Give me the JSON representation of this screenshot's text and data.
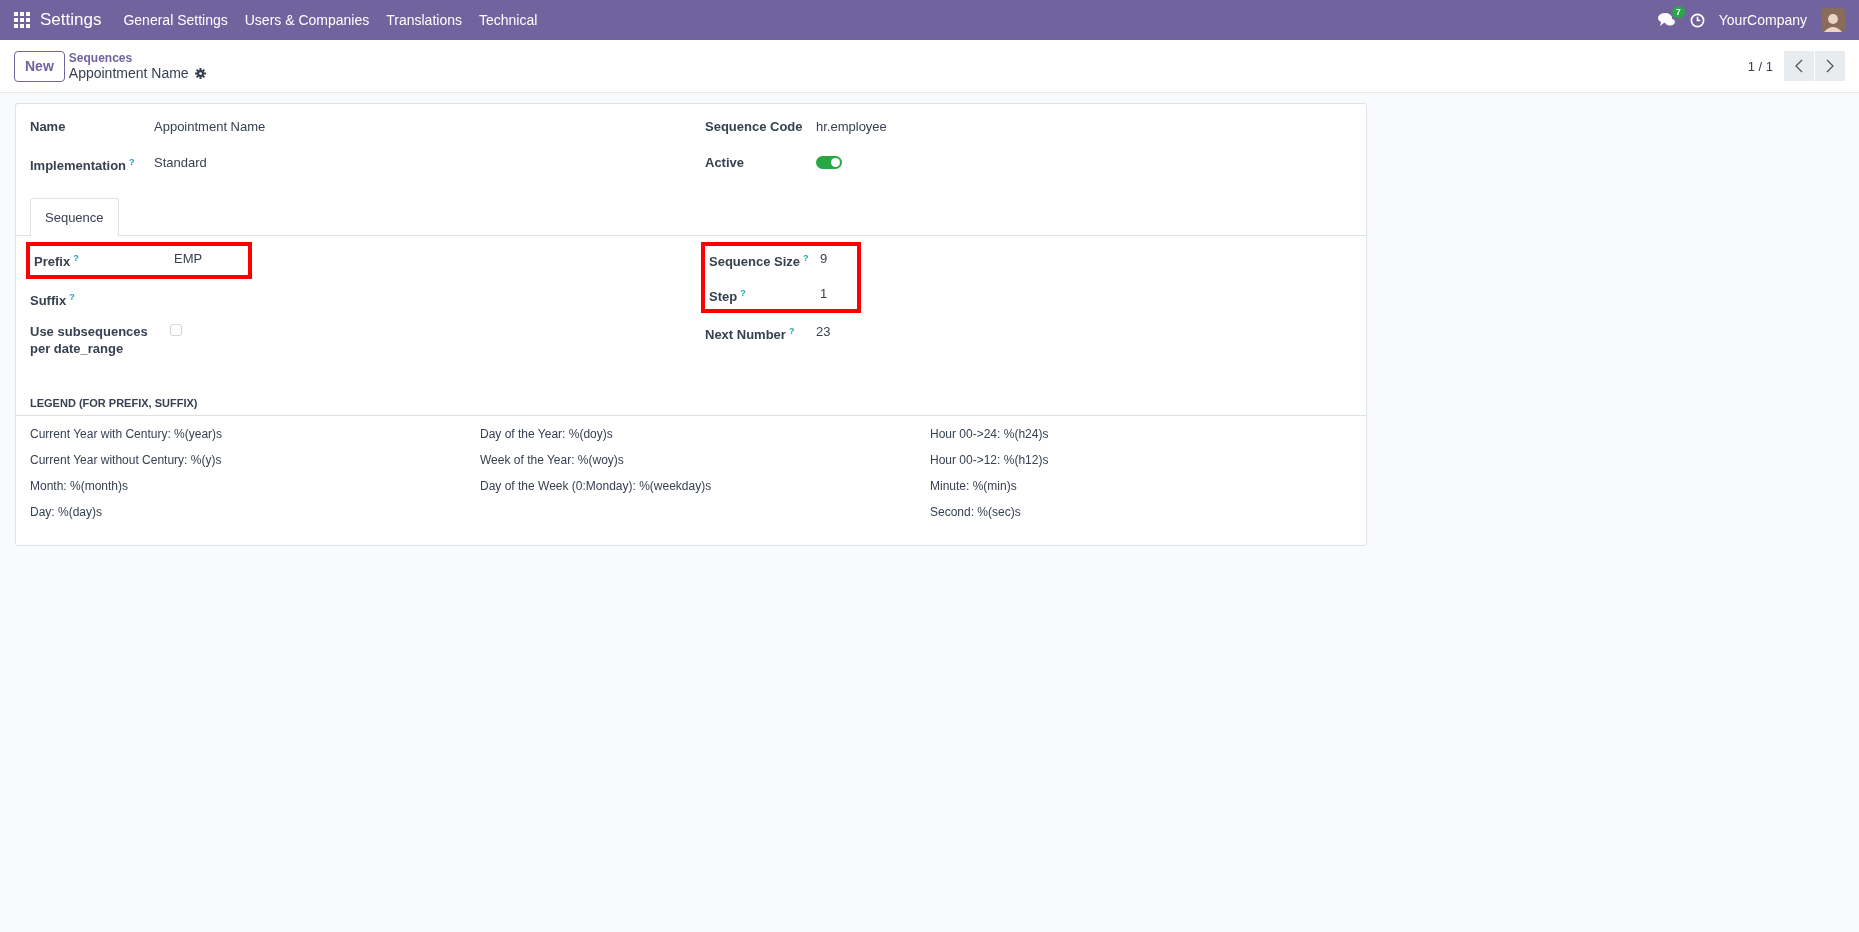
{
  "navbar": {
    "app": "Settings",
    "menus": [
      "General Settings",
      "Users & Companies",
      "Translations",
      "Technical"
    ],
    "messages_badge": "7",
    "company": "YourCompany"
  },
  "control_panel": {
    "new_button": "New",
    "breadcrumb": "Sequences",
    "record": "Appointment Name",
    "pager": "1 / 1"
  },
  "header_left": [
    {
      "label": "Name",
      "value": "Appointment Name",
      "kind": "text"
    },
    {
      "label": "Implementation",
      "help": "?",
      "value": "Standard",
      "kind": "text"
    }
  ],
  "header_right": [
    {
      "label": "Sequence Code",
      "value": "hr.employee",
      "kind": "text"
    },
    {
      "label": "Active",
      "kind": "toggle",
      "on": true
    }
  ],
  "tabs": [
    {
      "label": "Sequence",
      "selected": true
    }
  ],
  "fields_left": [
    {
      "label": "Prefix",
      "help": "?",
      "value": "EMP",
      "kind": "text",
      "highlighted": true
    },
    {
      "label": "Suffix",
      "help": "?",
      "kind": "text",
      "highlighted": false
    },
    {
      "label": "Use subsequences per date_range",
      "kind": "checkbox",
      "checked": false,
      "highlighted": false
    }
  ],
  "fields_right": [
    {
      "label": "Sequence Size",
      "help": "?",
      "value": "9",
      "kind": "text",
      "highlighted": true
    },
    {
      "label": "Step",
      "help": "?",
      "value": "1",
      "kind": "text",
      "highlighted": true
    },
    {
      "label": "Next Number",
      "help": "?",
      "value": "23",
      "kind": "text",
      "highlighted": false
    }
  ],
  "legend": {
    "title": "LEGEND (FOR PREFIX, SUFFIX)",
    "columns": [
      [
        "Current Year with Century: %(year)s",
        "Current Year without Century: %(y)s",
        "Month: %(month)s",
        "Day: %(day)s"
      ],
      [
        "Day of the Year: %(doy)s",
        "Week of the Year: %(woy)s",
        "Day of the Week (0:Monday): %(weekday)s"
      ],
      [
        "Hour 00->24: %(h24)s",
        "Hour 00->12: %(h12)s",
        "Minute: %(min)s",
        "Second: %(sec)s"
      ]
    ]
  }
}
